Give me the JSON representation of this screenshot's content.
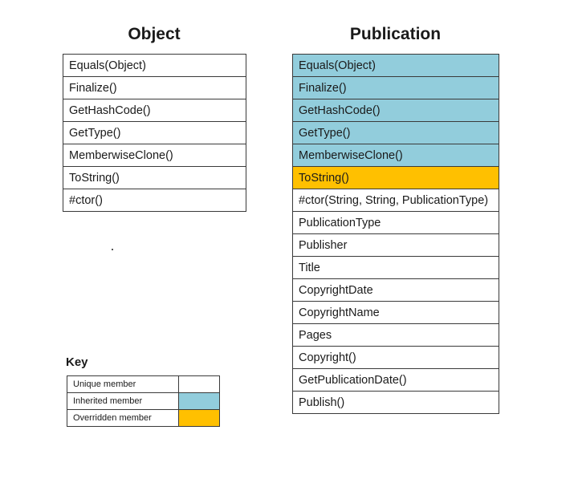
{
  "object": {
    "title": "Object",
    "members": [
      {
        "label": "Equals(Object)",
        "kind": "unique"
      },
      {
        "label": "Finalize()",
        "kind": "unique"
      },
      {
        "label": "GetHashCode()",
        "kind": "unique"
      },
      {
        "label": "GetType()",
        "kind": "unique"
      },
      {
        "label": "MemberwiseClone()",
        "kind": "unique"
      },
      {
        "label": "ToString()",
        "kind": "unique"
      },
      {
        "label": "#ctor()",
        "kind": "unique"
      }
    ]
  },
  "publication": {
    "title": "Publication",
    "members": [
      {
        "label": "Equals(Object)",
        "kind": "inherited"
      },
      {
        "label": "Finalize()",
        "kind": "inherited"
      },
      {
        "label": "GetHashCode()",
        "kind": "inherited"
      },
      {
        "label": "GetType()",
        "kind": "inherited"
      },
      {
        "label": "MemberwiseClone()",
        "kind": "inherited"
      },
      {
        "label": "ToString()",
        "kind": "overridden"
      },
      {
        "label": "#ctor(String,  String, PublicationType)",
        "kind": "unique"
      },
      {
        "label": "PublicationType",
        "kind": "unique"
      },
      {
        "label": "Publisher",
        "kind": "unique"
      },
      {
        "label": "Title",
        "kind": "unique"
      },
      {
        "label": "CopyrightDate",
        "kind": "unique"
      },
      {
        "label": "CopyrightName",
        "kind": "unique"
      },
      {
        "label": "Pages",
        "kind": "unique"
      },
      {
        "label": "Copyright()",
        "kind": "unique"
      },
      {
        "label": "GetPublicationDate()",
        "kind": "unique"
      },
      {
        "label": "Publish()",
        "kind": "unique"
      }
    ]
  },
  "key": {
    "title": "Key",
    "entries": [
      {
        "label": "Unique member",
        "kind": "unique"
      },
      {
        "label": "Inherited member",
        "kind": "inherited"
      },
      {
        "label": "Overridden member",
        "kind": "overridden"
      }
    ]
  },
  "colors": {
    "unique": "#ffffff",
    "inherited": "#92cddc",
    "overridden": "#ffc000"
  }
}
